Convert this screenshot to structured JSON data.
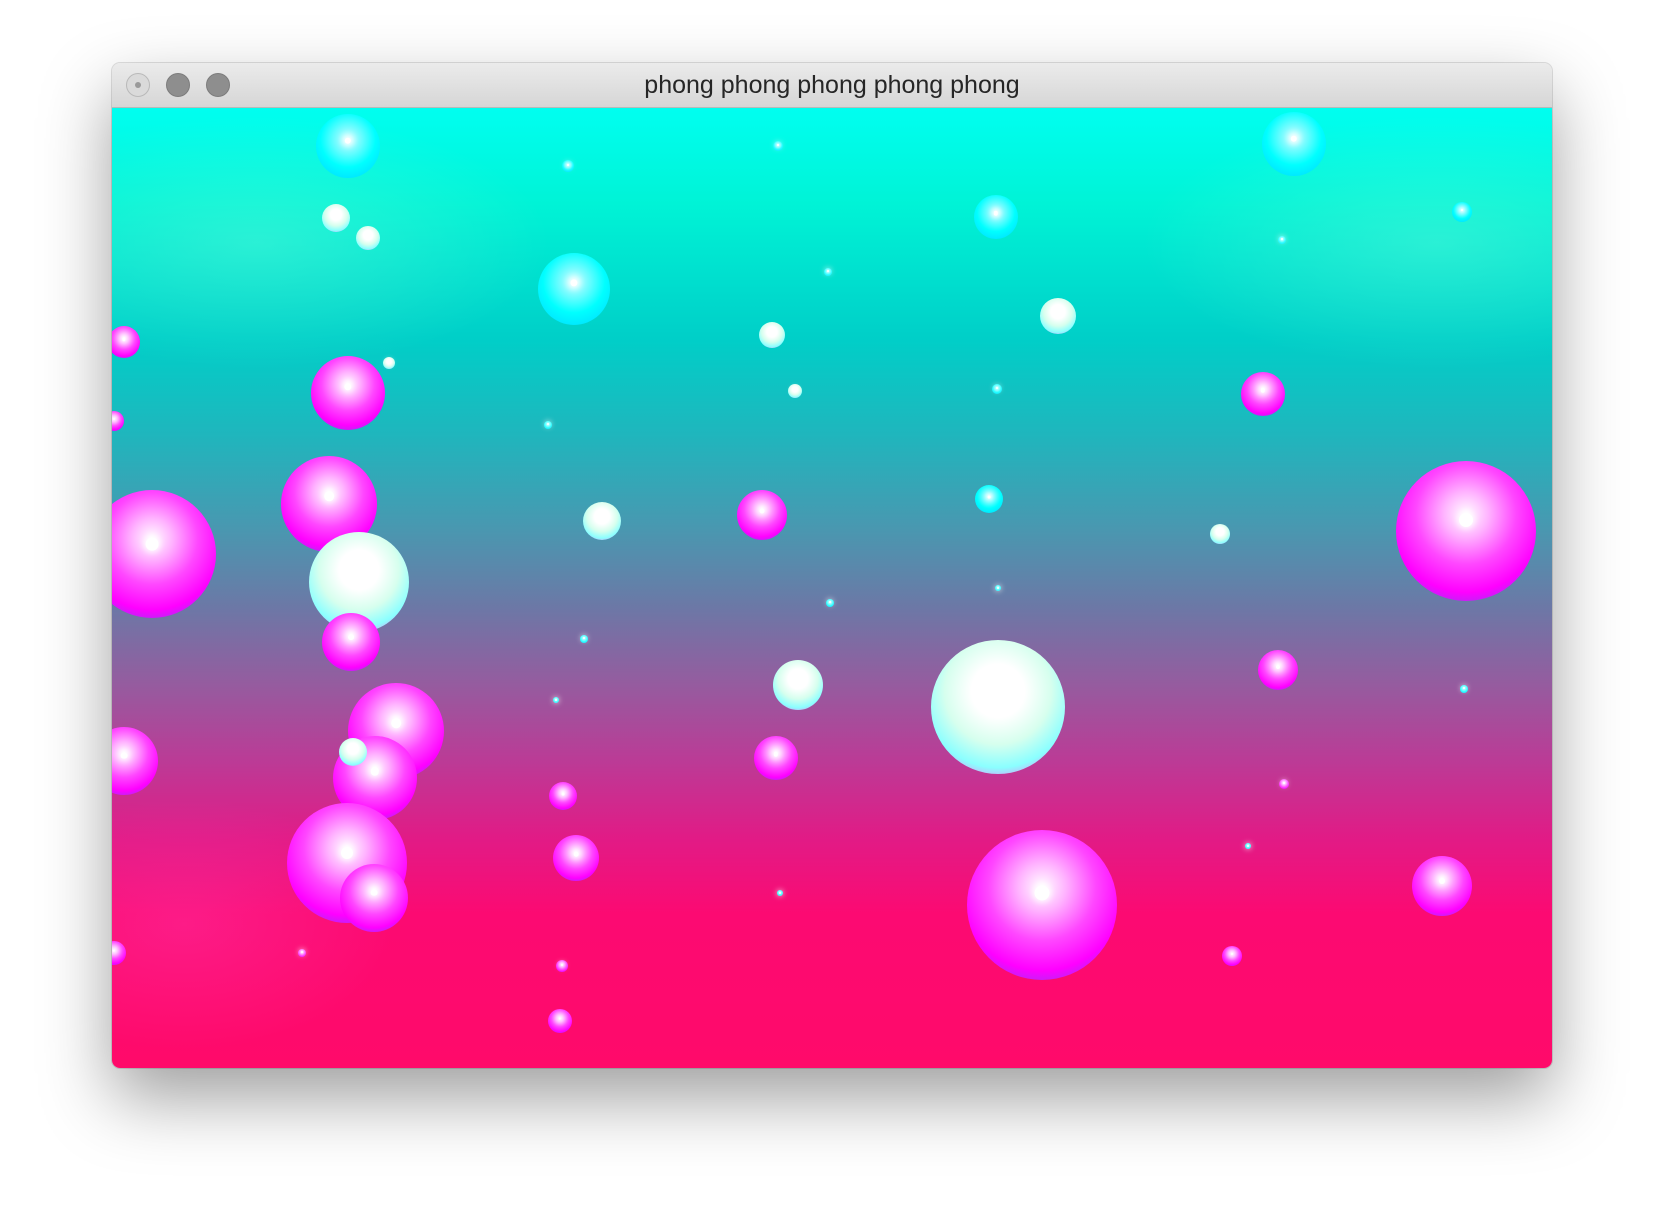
{
  "window": {
    "title": "phong phong phong phong phong"
  },
  "colors": {
    "cyan": "#00ffff",
    "magenta": "#ff00ff",
    "hot_pink": "#ff0a6a",
    "title_text": "#262626"
  }
}
